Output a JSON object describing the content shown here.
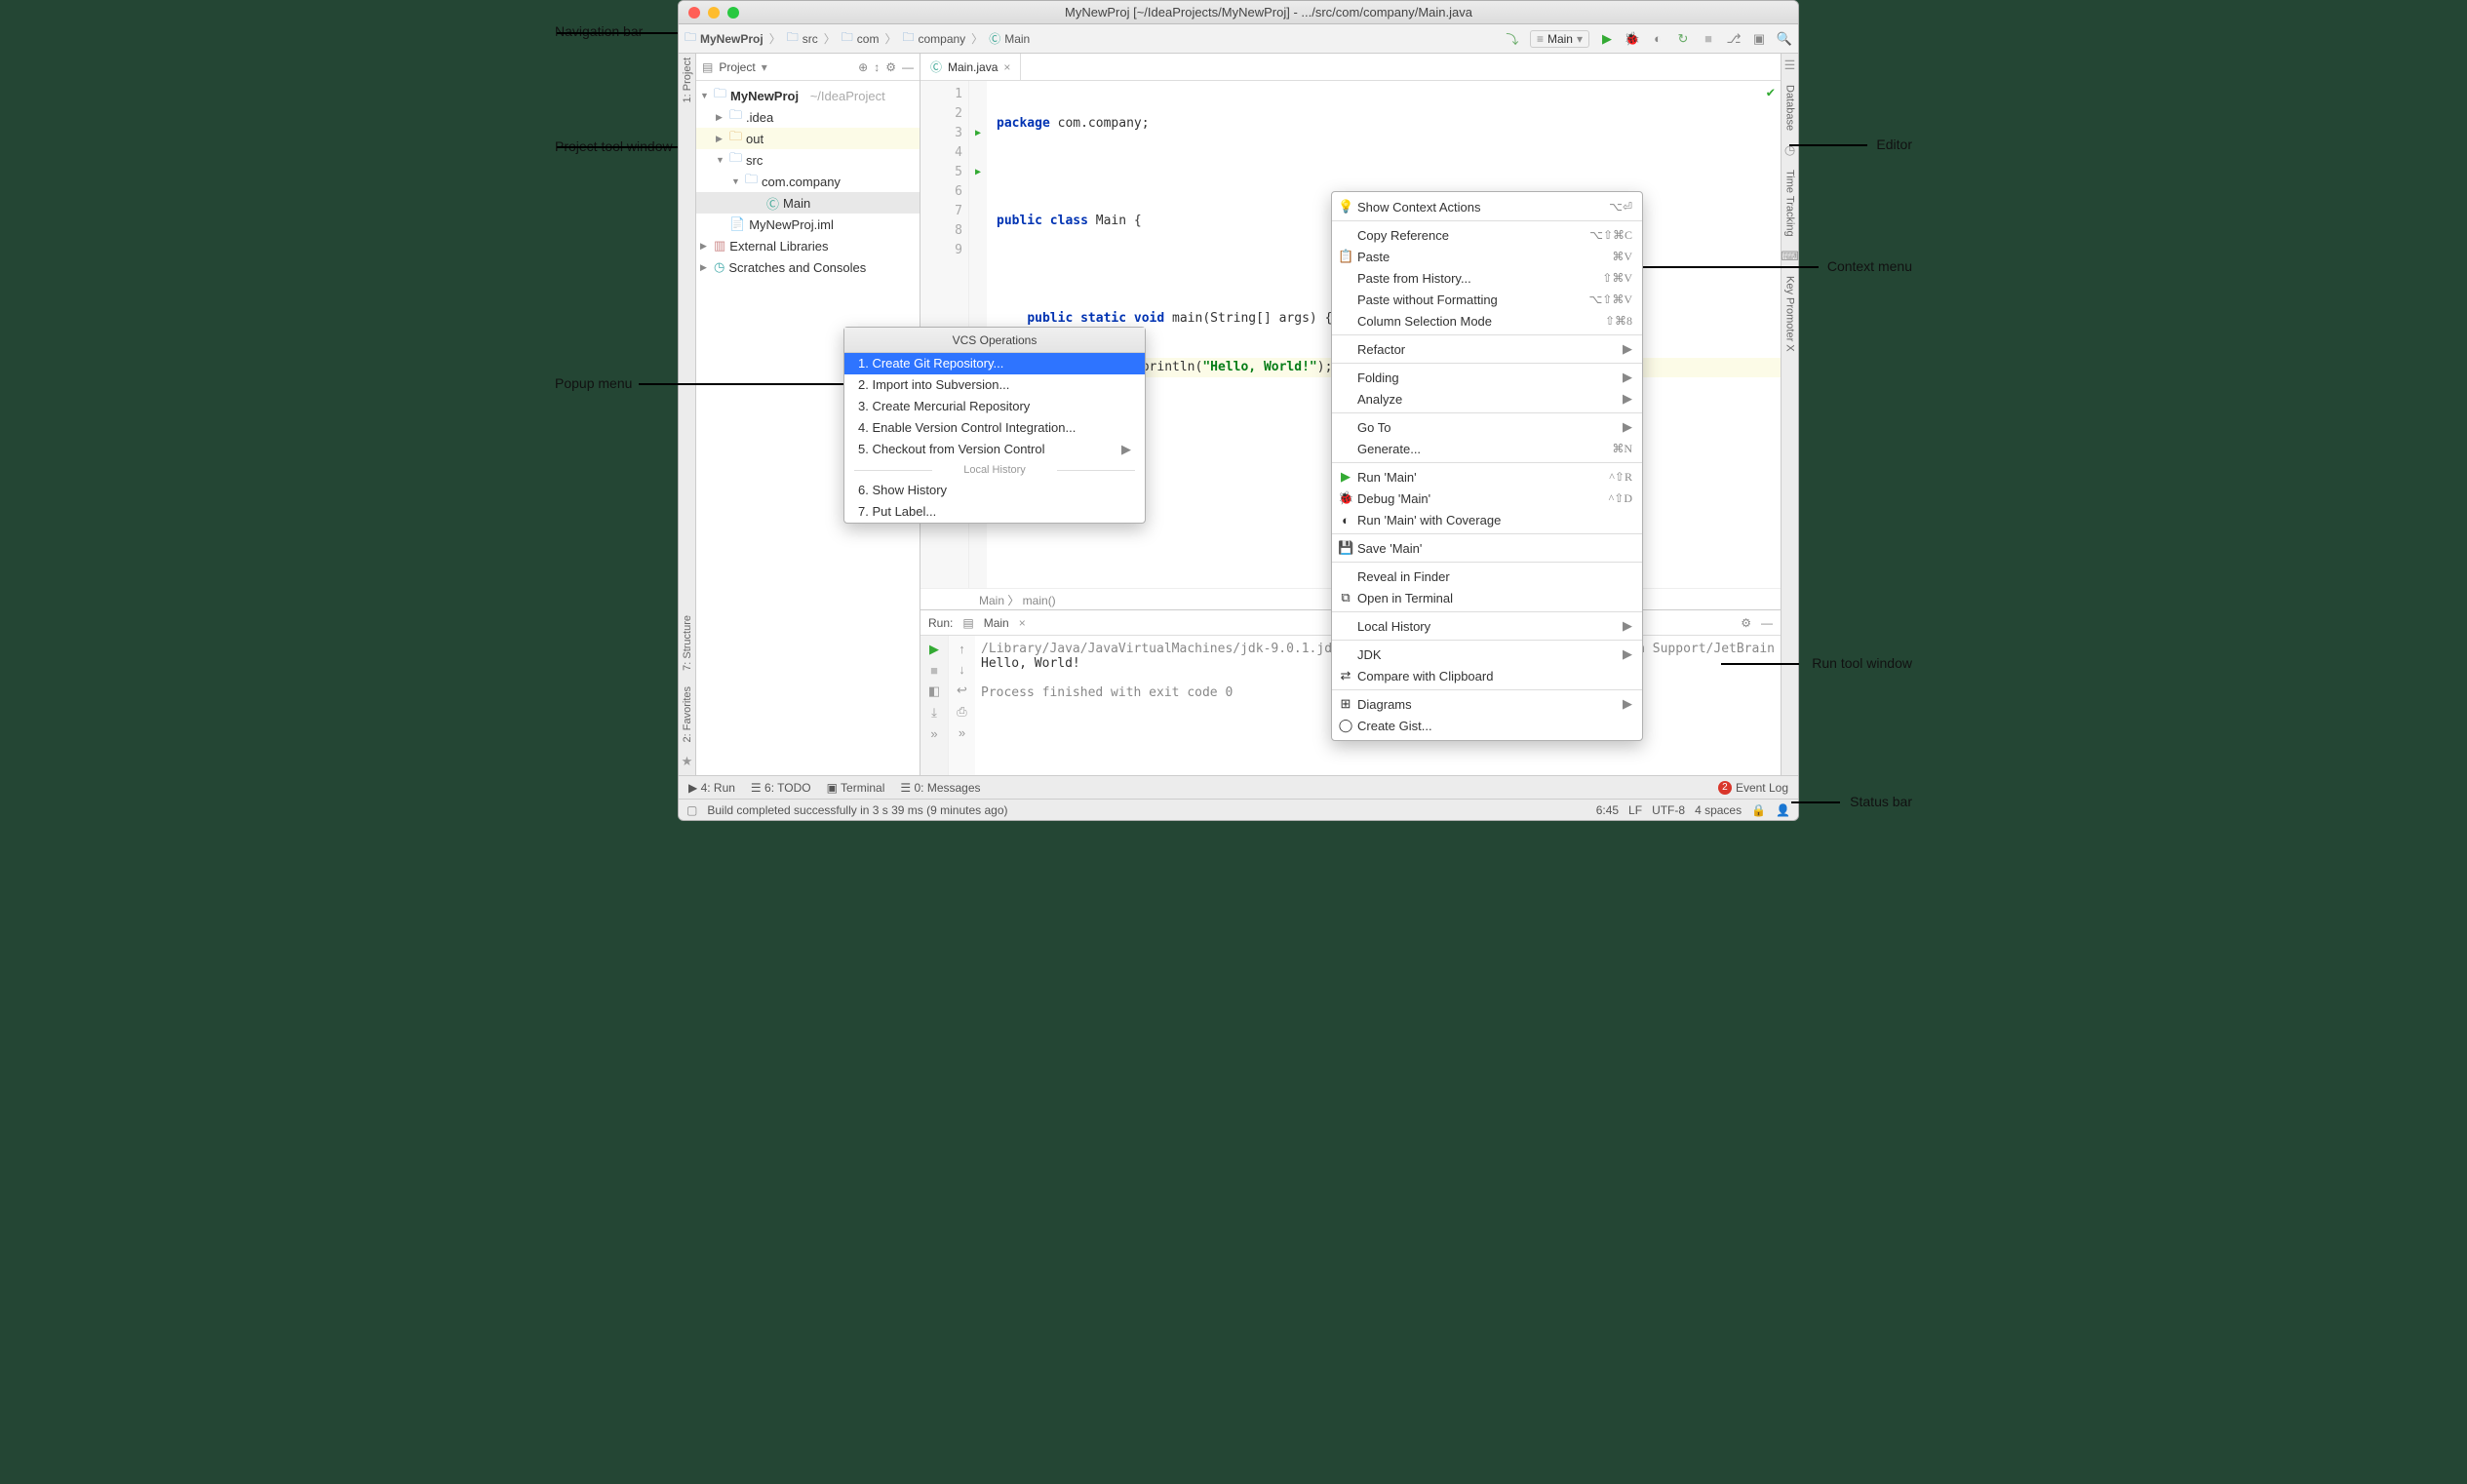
{
  "window": {
    "title": "MyNewProj [~/IdeaProjects/MyNewProj] - .../src/com/company/Main.java"
  },
  "breadcrumbs": [
    "MyNewProj",
    "src",
    "com",
    "company",
    "Main"
  ],
  "runConfig": "Main",
  "projectPanel": {
    "title": "Project",
    "rootName": "MyNewProj",
    "rootPath": "~/IdeaProject",
    "nodes": [
      ".idea",
      "out",
      "src",
      "com.company",
      "Main",
      "MyNewProj.iml",
      "External Libraries",
      "Scratches and Consoles"
    ]
  },
  "editor": {
    "tab": "Main.java",
    "lines": [
      "package com.company;",
      "",
      "public class Main {",
      "",
      "    public static void main(String[] args) {",
      "        System.out.println(\"Hello, World!\");",
      "    }",
      "}",
      ""
    ],
    "breadcrumb": "Main  〉  main()"
  },
  "runPanel": {
    "title": "Run:",
    "tab": "Main",
    "cmd": "/Library/Java/JavaVirtualMachines/jdk-9.0.1.jdk/Contents/Home/bin/java \"-j",
    "cmdTail": "n Support/JetBrain",
    "out": "Hello, World!",
    "exit": "Process finished with exit code 0"
  },
  "vcsPopup": {
    "title": "VCS Operations",
    "items": [
      "1. Create Git Repository...",
      "2. Import into Subversion...",
      "3. Create Mercurial Repository",
      "4. Enable Version Control Integration...",
      "5. Checkout from Version Control"
    ],
    "divider": "Local History",
    "items2": [
      "6. Show History",
      "7. Put Label..."
    ]
  },
  "contextMenu": {
    "items": [
      {
        "icon": "💡",
        "label": "Show Context Actions",
        "shortcut": "⌥⏎"
      },
      {
        "sep": true
      },
      {
        "label": "Copy Reference",
        "shortcut": "⌥⇧⌘C"
      },
      {
        "icon": "📋",
        "label": "Paste",
        "shortcut": "⌘V"
      },
      {
        "label": "Paste from History...",
        "shortcut": "⇧⌘V"
      },
      {
        "label": "Paste without Formatting",
        "shortcut": "⌥⇧⌘V"
      },
      {
        "label": "Column Selection Mode",
        "shortcut": "⇧⌘8"
      },
      {
        "sep": true
      },
      {
        "label": "Refactor",
        "sub": "▶"
      },
      {
        "sep": true
      },
      {
        "label": "Folding",
        "sub": "▶"
      },
      {
        "label": "Analyze",
        "sub": "▶"
      },
      {
        "sep": true
      },
      {
        "label": "Go To",
        "sub": "▶"
      },
      {
        "label": "Generate...",
        "shortcut": "⌘N"
      },
      {
        "sep": true
      },
      {
        "icon": "▶",
        "iconColor": "#3a3",
        "label": "Run 'Main'",
        "shortcut": "^⇧R"
      },
      {
        "icon": "🐞",
        "iconColor": "#3a3",
        "label": "Debug 'Main'",
        "shortcut": "^⇧D"
      },
      {
        "icon": "◐",
        "label": "Run 'Main' with Coverage"
      },
      {
        "sep": true
      },
      {
        "icon": "💾",
        "label": "Save 'Main'"
      },
      {
        "sep": true
      },
      {
        "label": "Reveal in Finder"
      },
      {
        "icon": "⧉",
        "label": "Open in Terminal"
      },
      {
        "sep": true
      },
      {
        "label": "Local History",
        "sub": "▶"
      },
      {
        "sep": true
      },
      {
        "label": "JDK",
        "sub": "▶"
      },
      {
        "icon": "⇄",
        "label": "Compare with Clipboard"
      },
      {
        "sep": true
      },
      {
        "icon": "⊞",
        "label": "Diagrams",
        "sub": "▶"
      },
      {
        "icon": "◯",
        "label": "Create Gist..."
      }
    ]
  },
  "leftStrip": [
    "1: Project",
    "7: Structure",
    "2: Favorites"
  ],
  "rightStrip": [
    "Database",
    "Time Tracking",
    "Key Promoter X"
  ],
  "bottomTabs": [
    "▶ 4: Run",
    "☰ 6: TODO",
    "▣ Terminal",
    "☰ 0: Messages"
  ],
  "eventLog": {
    "count": "2",
    "label": "Event Log"
  },
  "status": {
    "msg": "Build completed successfully in 3 s 39 ms (9 minutes ago)",
    "pos": "6:45",
    "le": "LF",
    "enc": "UTF-8",
    "indent": "4 spaces"
  },
  "callouts": {
    "nav": "Navigation bar",
    "proj": "Project tool window",
    "popup": "Popup menu",
    "editor": "Editor",
    "ctx": "Context menu",
    "run": "Run tool window",
    "status": "Status bar"
  }
}
